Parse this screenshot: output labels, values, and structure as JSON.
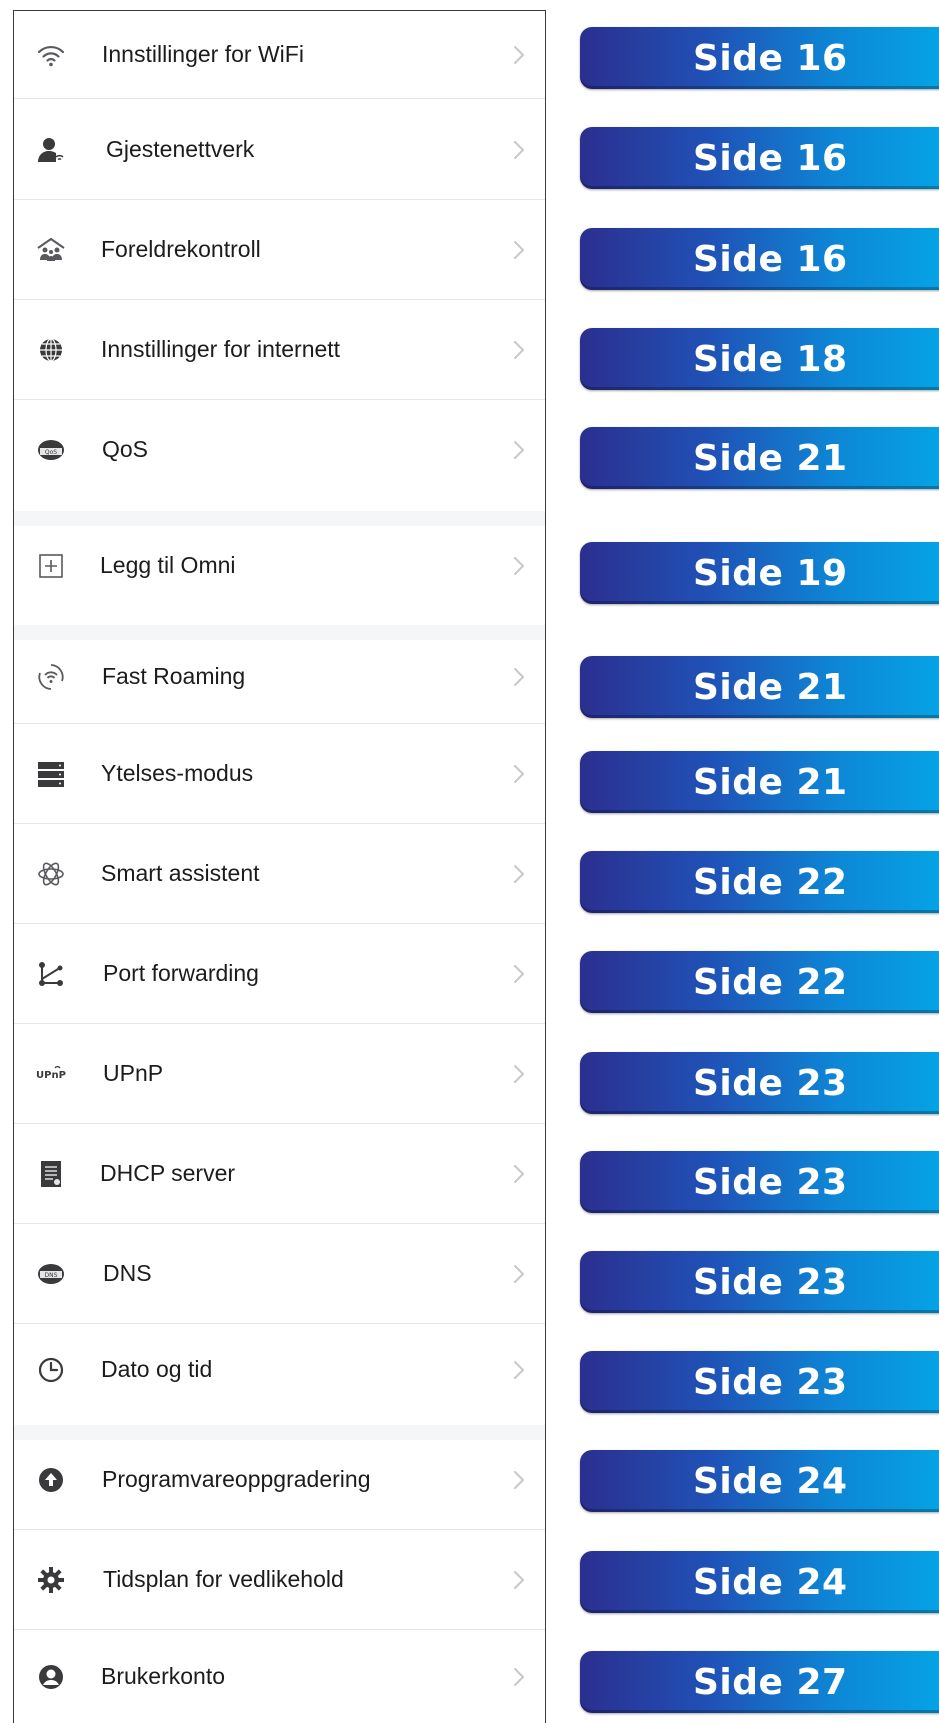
{
  "settings": {
    "items": [
      {
        "label": "Innstillinger for WiFi",
        "icon": "wifi-icon",
        "page": "Side 16"
      },
      {
        "label": "Gjestenettverk",
        "icon": "guest-user-icon",
        "page": "Side 16"
      },
      {
        "label": "Foreldrekontroll",
        "icon": "family-house-icon",
        "page": "Side 16"
      },
      {
        "label": "Innstillinger for internett",
        "icon": "globe-icon",
        "page": "Side 18"
      },
      {
        "label": "QoS",
        "icon": "qos-icon",
        "page": "Side 21"
      },
      {
        "label": "Legg til Omni",
        "icon": "add-box-icon",
        "page": "Side 19"
      },
      {
        "label": "Fast Roaming",
        "icon": "wifi-roaming-icon",
        "page": "Side 21"
      },
      {
        "label": "Ytelses-modus",
        "icon": "server-icon",
        "page": "Side 21"
      },
      {
        "label": "Smart assistent",
        "icon": "atom-icon",
        "page": "Side 22"
      },
      {
        "label": "Port forwarding",
        "icon": "port-forward-icon",
        "page": "Side 22"
      },
      {
        "label": "UPnP",
        "icon": "upnp-icon",
        "page": "Side 23"
      },
      {
        "label": "DHCP server",
        "icon": "document-icon",
        "page": "Side 23"
      },
      {
        "label": "DNS",
        "icon": "dns-icon",
        "page": "Side 23"
      },
      {
        "label": "Dato og tid",
        "icon": "clock-icon",
        "page": "Side 23"
      },
      {
        "label": "Programvareoppgradering",
        "icon": "upgrade-arrow-icon",
        "page": "Side 24"
      },
      {
        "label": "Tidsplan for vedlikehold",
        "icon": "gear-icon",
        "page": "Side 24"
      },
      {
        "label": "Brukerkonto",
        "icon": "account-icon",
        "page": "Side 27"
      }
    ]
  },
  "colors": {
    "badge_start": "#2b2f8f",
    "badge_end": "#05a5e6",
    "text": "#1c1c1e",
    "chevron": "#c7c7cc",
    "icon": "#5a5a5e"
  }
}
